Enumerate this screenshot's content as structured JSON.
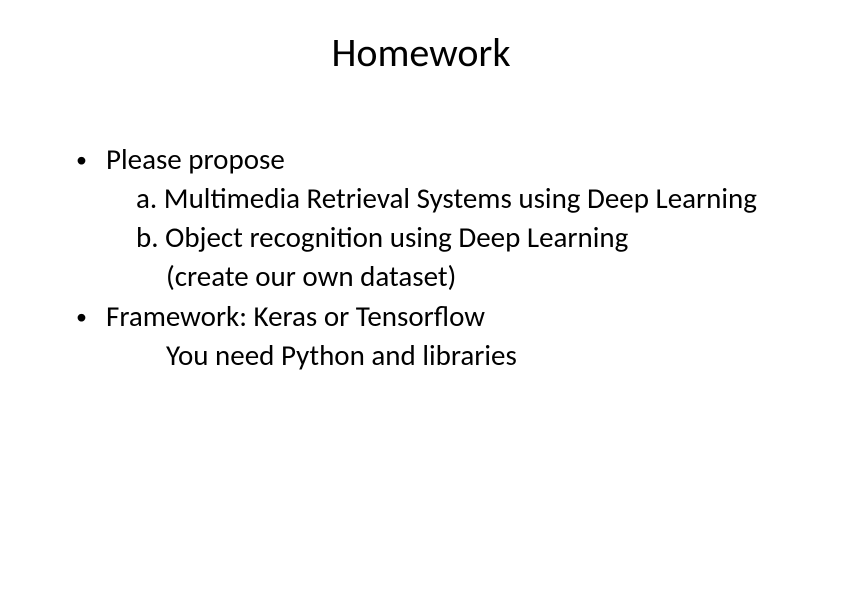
{
  "title": "Homework",
  "bullets": [
    {
      "lead": "Please propose",
      "lines": [
        "a. Multimedia Retrieval Systems using Deep Learning",
        "b. Object recognition using Deep Learning",
        "(create our own dataset)"
      ]
    },
    {
      "lead": "Framework: Keras or Tensorflow",
      "lines": [
        "You need Python and libraries"
      ]
    }
  ]
}
